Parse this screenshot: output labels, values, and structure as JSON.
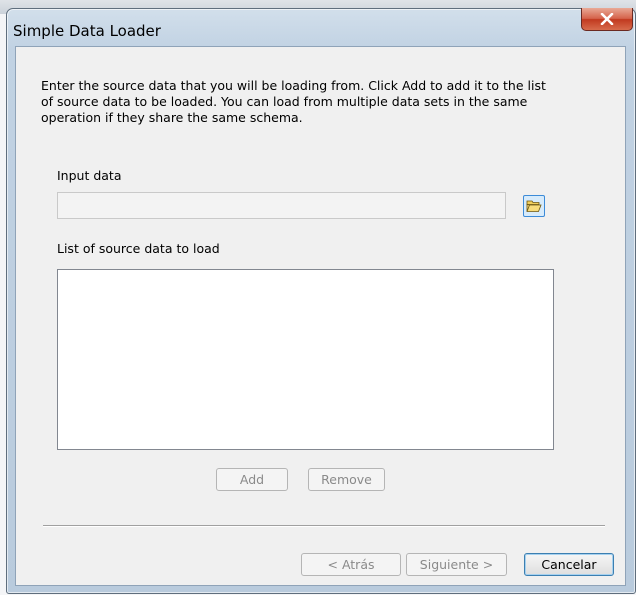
{
  "window": {
    "title": "Simple Data Loader"
  },
  "intro_text": "Enter the source data that you will be loading from. Click Add to add it to the list of source data to be loaded. You can load from multiple data sets in the same operation if they share the same schema.",
  "input_data": {
    "label": "Input data",
    "value": "",
    "browse_icon": "folder-open-icon"
  },
  "source_list": {
    "label": "List of source data to load",
    "items": []
  },
  "buttons": {
    "add": "Add",
    "remove": "Remove",
    "back": "< Atrás",
    "next": "Siguiente >",
    "cancel": "Cancelar"
  },
  "colors": {
    "close_button": "#c1391f",
    "browse_button": "#d7ebfb"
  }
}
